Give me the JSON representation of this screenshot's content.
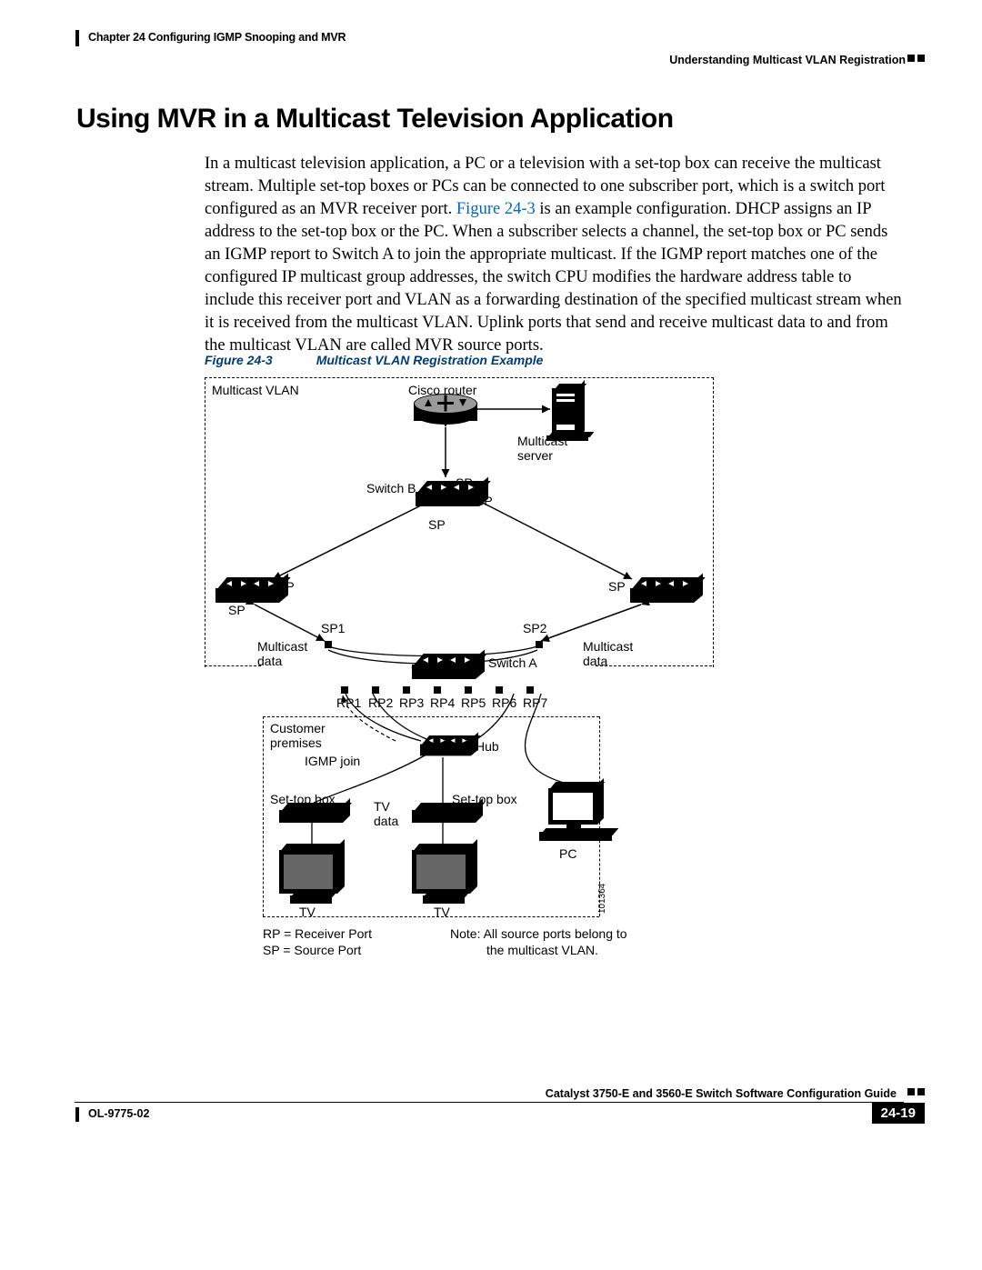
{
  "header": {
    "chapter_line": "Chapter 24    Configuring IGMP Snooping and MVR",
    "section_line": "Understanding Multicast VLAN Registration"
  },
  "heading": "Using MVR in a Multicast Television Application",
  "body": {
    "p1a": "In a multicast television application, a PC or a television with a set-top box can receive the multicast stream. Multiple set-top boxes or PCs can be connected to one subscriber port, which is a switch port configured as an MVR receiver port. ",
    "figref": "Figure 24-3",
    "p1b": " is an example configuration. DHCP assigns an IP address to the set-top box or the PC. When a subscriber selects a channel, the set-top box or PC sends an IGMP report to Switch A to join the appropriate multicast. If the IGMP report matches one of the configured IP multicast group addresses, the switch CPU modifies the hardware address table to include this receiver port and VLAN as a forwarding destination of the specified multicast stream when it is received from the multicast VLAN. Uplink ports that send and receive multicast data to and from the multicast VLAN are called MVR source ports."
  },
  "figure": {
    "number": "Figure 24-3",
    "title": "Multicast VLAN Registration Example"
  },
  "diagram": {
    "multicast_vlan": "Multicast VLAN",
    "cisco_router": "Cisco router",
    "multicast_server": "Multicast\nserver",
    "switch_b": "Switch B",
    "switch_a": "Switch A",
    "sp": "SP",
    "sp1": "SP1",
    "sp2": "SP2",
    "multicast_data_l": "Multicast\ndata",
    "multicast_data_r": "Multicast\ndata",
    "rp_labels": [
      "RP1",
      "RP2",
      "RP3",
      "RP4",
      "RP5",
      "RP6",
      "RP7"
    ],
    "customer_premises": "Customer\npremises",
    "hub": "Hub",
    "igmp_join": "IGMP join",
    "settop_l": "Set-top box",
    "settop_r": "Set-top box",
    "tv_data": "TV\ndata",
    "tv_l": "TV",
    "tv_r": "TV",
    "pc": "PC",
    "id": "101364",
    "legend_rp": "RP = Receiver Port",
    "legend_sp": "SP = Source Port",
    "note_a": "Note: All source ports belong to",
    "note_b": "the multicast VLAN."
  },
  "footer": {
    "guide": "Catalyst 3750-E and 3560-E Switch Software Configuration Guide",
    "docnum": "OL-9775-02",
    "page": "24-19"
  }
}
